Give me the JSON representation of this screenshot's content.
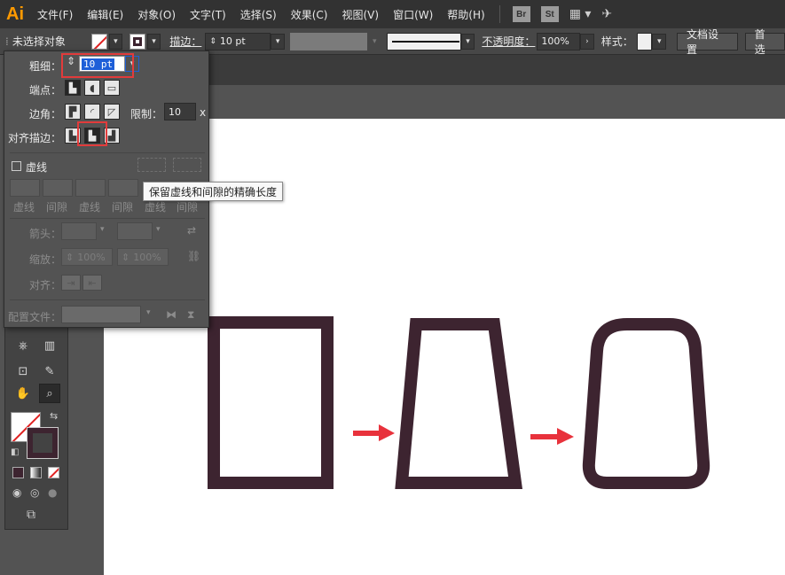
{
  "app": {
    "logo": "Ai"
  },
  "menu": {
    "items": [
      "文件(F)",
      "编辑(E)",
      "对象(O)",
      "文字(T)",
      "选择(S)",
      "效果(C)",
      "视图(V)",
      "窗口(W)",
      "帮助(H)"
    ],
    "badges": [
      "Br",
      "St"
    ]
  },
  "controlbar": {
    "selection_status": "未选择对象",
    "stroke_label": "描边：",
    "stroke_weight": "10 pt",
    "opacity_label": "不透明度：",
    "opacity_value": "100%",
    "style_label": "样式：",
    "doc_setup_button": "文档设置",
    "preferences_button": "首选"
  },
  "stroke_panel": {
    "weight_label": "粗细：",
    "weight_value": "10 pt",
    "cap_label": "端点：",
    "corner_label": "边角：",
    "limit_label": "限制：",
    "limit_value": "10",
    "limit_unit": "x",
    "align_label": "对齐描边：",
    "dashed_label": "虚线",
    "dash_labels": [
      "虚线",
      "间隙",
      "虚线",
      "间隙",
      "虚线",
      "间隙"
    ],
    "arrow_label": "箭头：",
    "scale_label": "缩放：",
    "scale_start": "100%",
    "scale_end": "100%",
    "align2_label": "对齐：",
    "profile_label": "配置文件："
  },
  "tooltip": {
    "text": "保留虚线和间隙的精确长度"
  },
  "colors": {
    "shape_stroke": "#3d2430",
    "arrow": "#e8323c",
    "highlight": "#e23b3b"
  },
  "canvas": {
    "shapes": [
      "rectangle-outline",
      "trapezoid-outline",
      "rounded-trapezoid-outline"
    ],
    "arrows": 2
  }
}
